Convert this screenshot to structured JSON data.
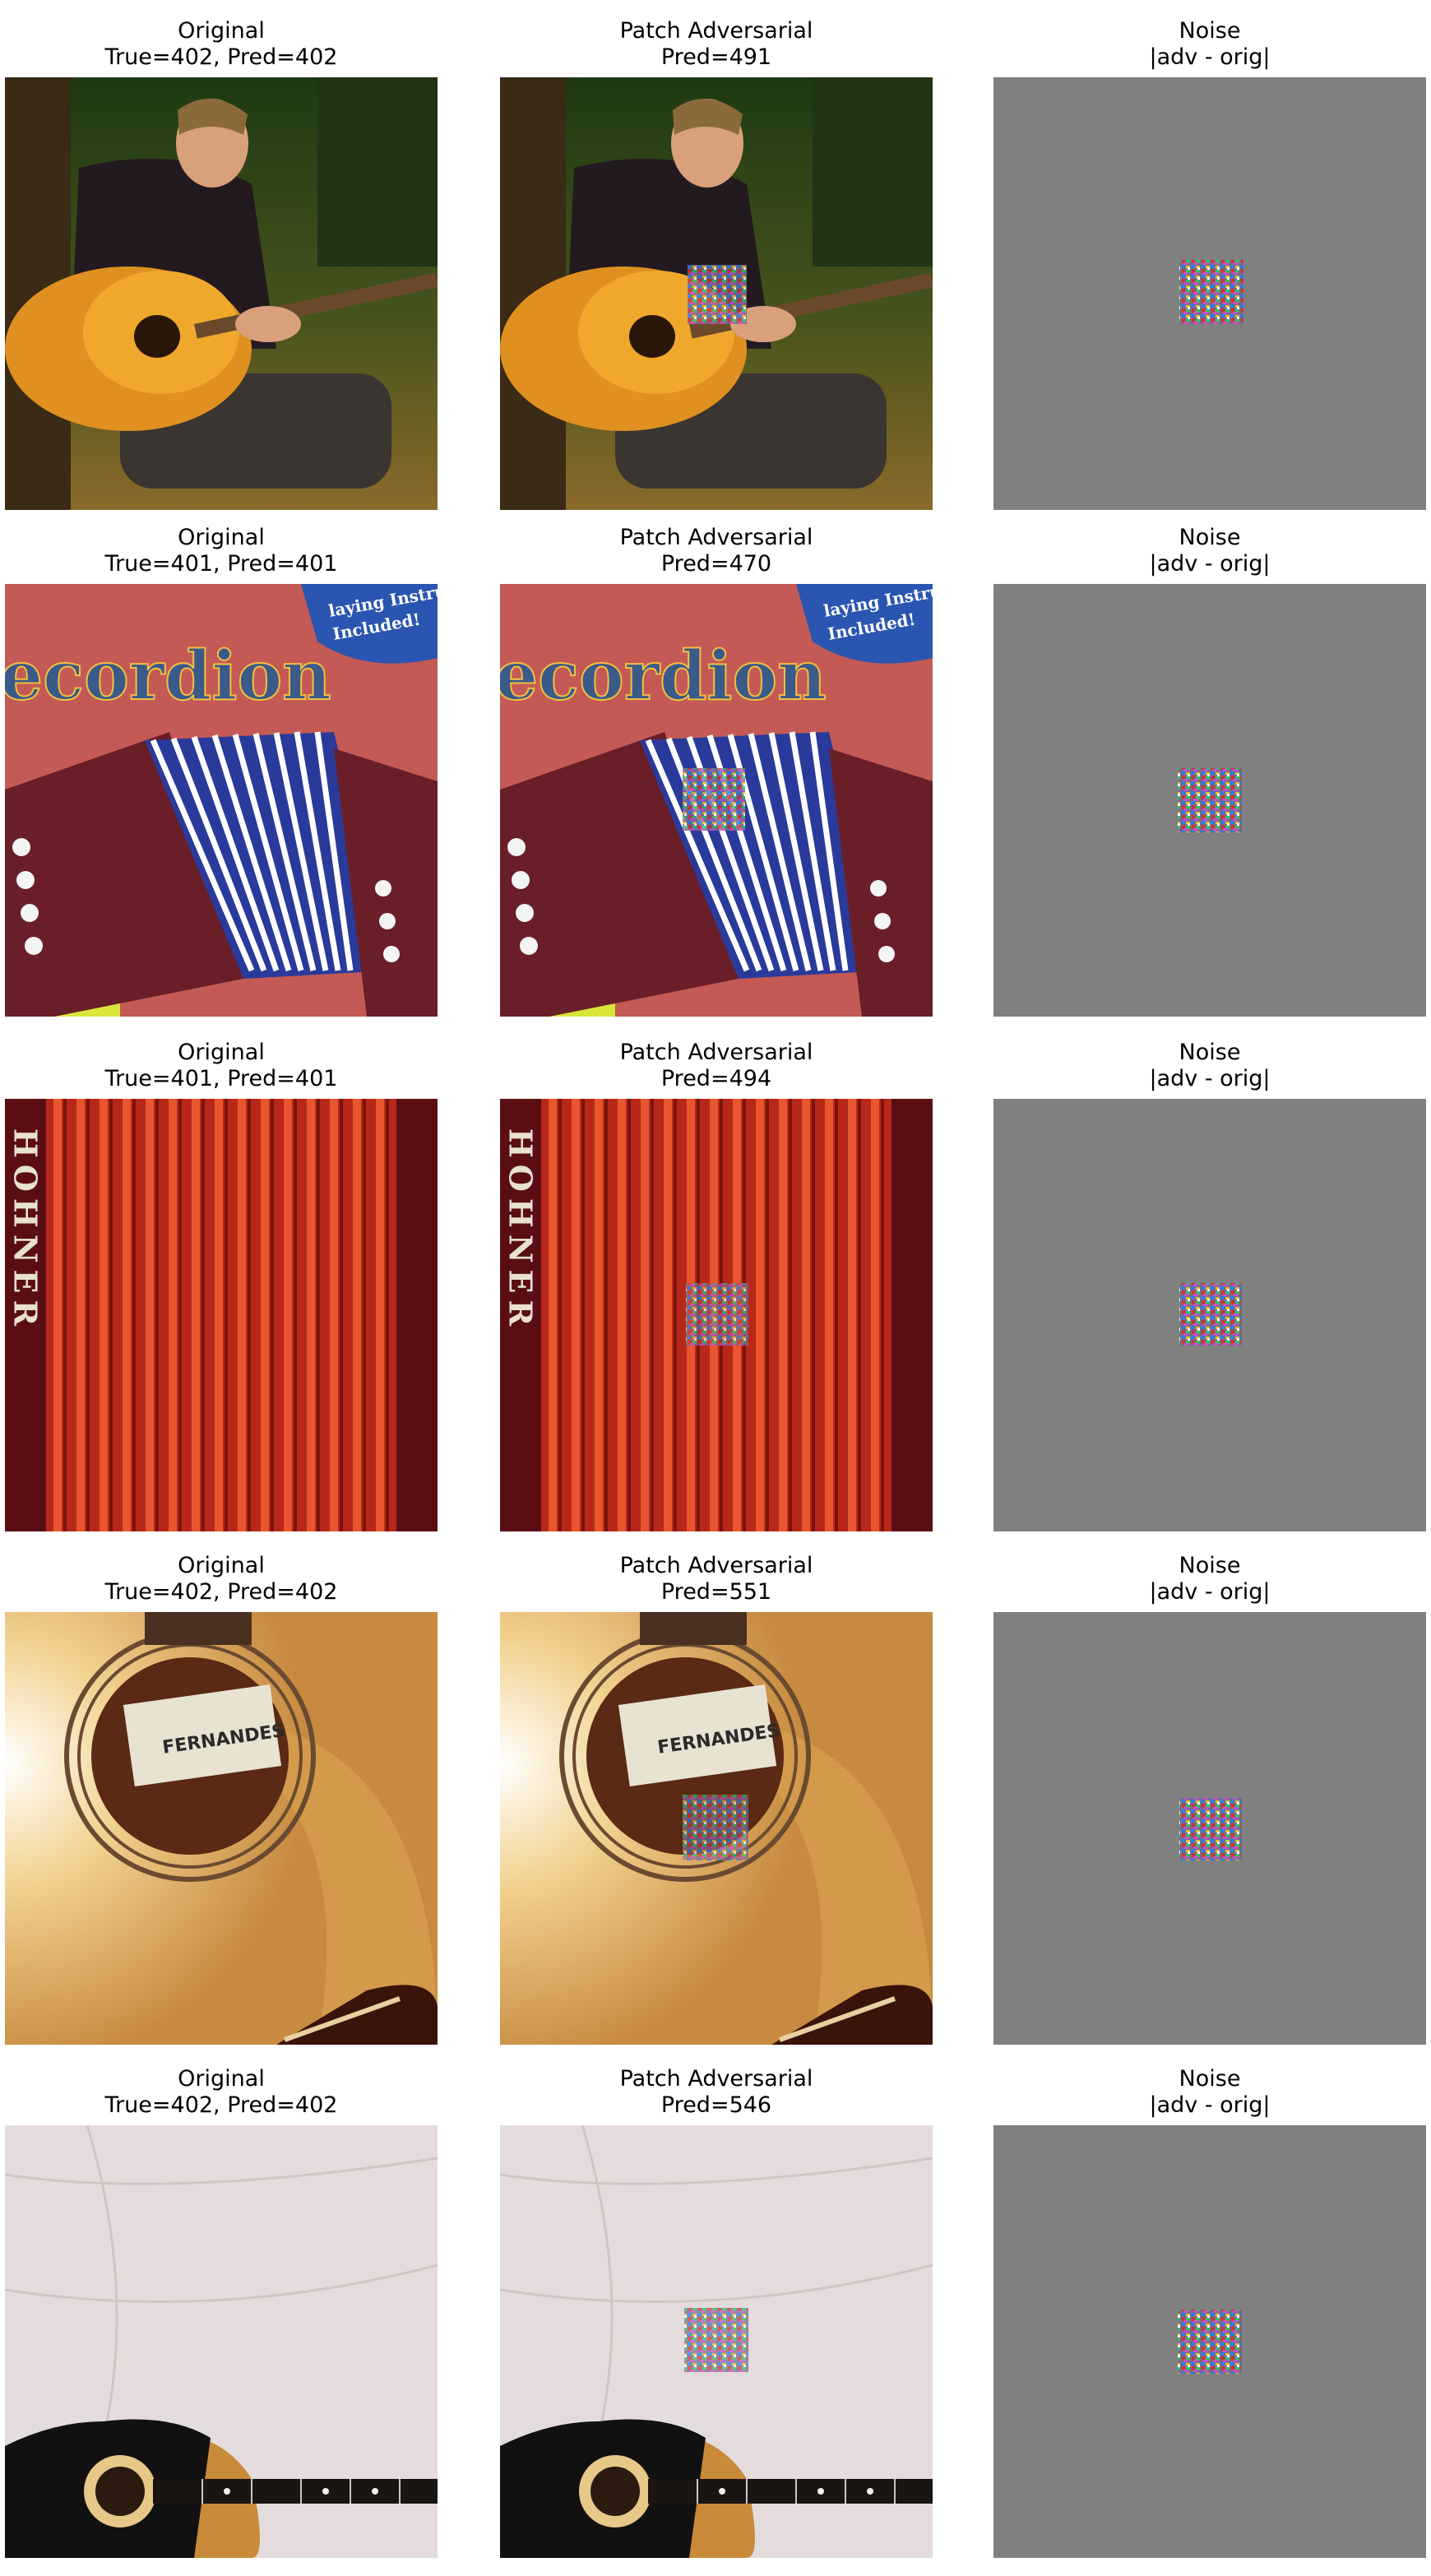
{
  "rows": [
    {
      "original": {
        "title": "Original",
        "subtitle": "True=402, Pred=402",
        "scene": "guitarist-playing-acoustic-guitar"
      },
      "adversarial": {
        "title": "Patch Adversarial",
        "subtitle": "Pred=491"
      },
      "noise": {
        "title": "Noise",
        "subtitle": "|adv - orig|"
      }
    },
    {
      "original": {
        "title": "Original",
        "subtitle": "True=401, Pred=401",
        "scene": "accordion-book-cover",
        "cover_word": "ecordion",
        "cover_badge_line1": "laying Instru",
        "cover_badge_line2": "Included!"
      },
      "adversarial": {
        "title": "Patch Adversarial",
        "subtitle": "Pred=470"
      },
      "noise": {
        "title": "Noise",
        "subtitle": "|adv - orig|"
      }
    },
    {
      "original": {
        "title": "Original",
        "subtitle": "True=401, Pred=401",
        "scene": "accordion-bellows-closeup",
        "brand": "HOHNER"
      },
      "adversarial": {
        "title": "Patch Adversarial",
        "subtitle": "Pred=494"
      },
      "noise": {
        "title": "Noise",
        "subtitle": "|adv - orig|"
      }
    },
    {
      "original": {
        "title": "Original",
        "subtitle": "True=402, Pred=402",
        "scene": "acoustic-guitar-soundhole-label",
        "label_text": "FERNANDES"
      },
      "adversarial": {
        "title": "Patch Adversarial",
        "subtitle": "Pred=551"
      },
      "noise": {
        "title": "Noise",
        "subtitle": "|adv - orig|"
      }
    },
    {
      "original": {
        "title": "Original",
        "subtitle": "True=402, Pred=402",
        "scene": "black-guitar-on-white-cloth"
      },
      "adversarial": {
        "title": "Patch Adversarial",
        "subtitle": "Pred=546"
      },
      "noise": {
        "title": "Noise",
        "subtitle": "|adv - orig|"
      }
    }
  ],
  "colors": {
    "noise_background": "#808080",
    "page_background": "#ffffff"
  }
}
